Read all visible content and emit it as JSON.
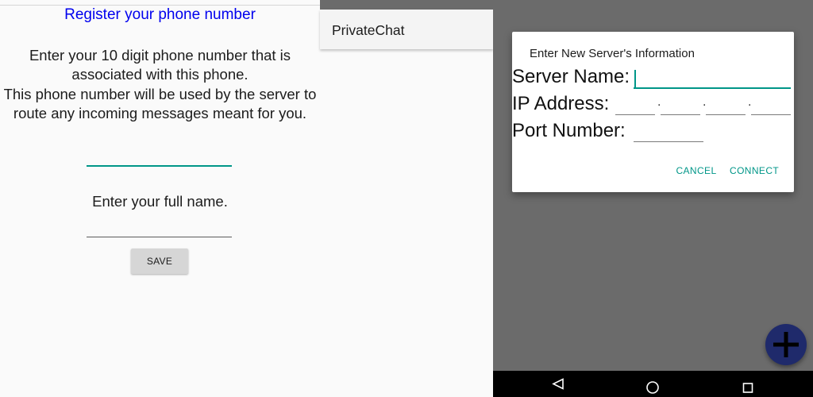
{
  "register": {
    "title": "Register your phone number",
    "instructions_line1": "Enter your 10 digit phone number that is associated with this phone.",
    "instructions_line2": "This phone number will be used by the server to route any incoming messages meant for you.",
    "phone_value": "",
    "name_label": "Enter your full name.",
    "name_value": "",
    "save_label": "SAVE"
  },
  "chat": {
    "appbar_title": "PrivateChat"
  },
  "dialog": {
    "title": "Enter New Server's Information",
    "server_name_label": "Server Name:",
    "server_name_value": "",
    "ip_label": "IP Address:",
    "ip_octets": [
      "",
      "",
      "",
      ""
    ],
    "ip_separator": ".",
    "port_label": "Port Number:",
    "port_value": "",
    "cancel_label": "CANCEL",
    "connect_label": "CONNECT"
  },
  "fab": {
    "icon": "plus-icon"
  },
  "navbar": {
    "icons": [
      "back-triangle-icon",
      "home-circle-icon",
      "recents-square-icon"
    ]
  },
  "colors": {
    "accent": "#009688",
    "title_blue": "#0000ee",
    "fab_background": "#1f2a6b",
    "scrim": "#6b6b6b",
    "navbar": "#000000"
  }
}
